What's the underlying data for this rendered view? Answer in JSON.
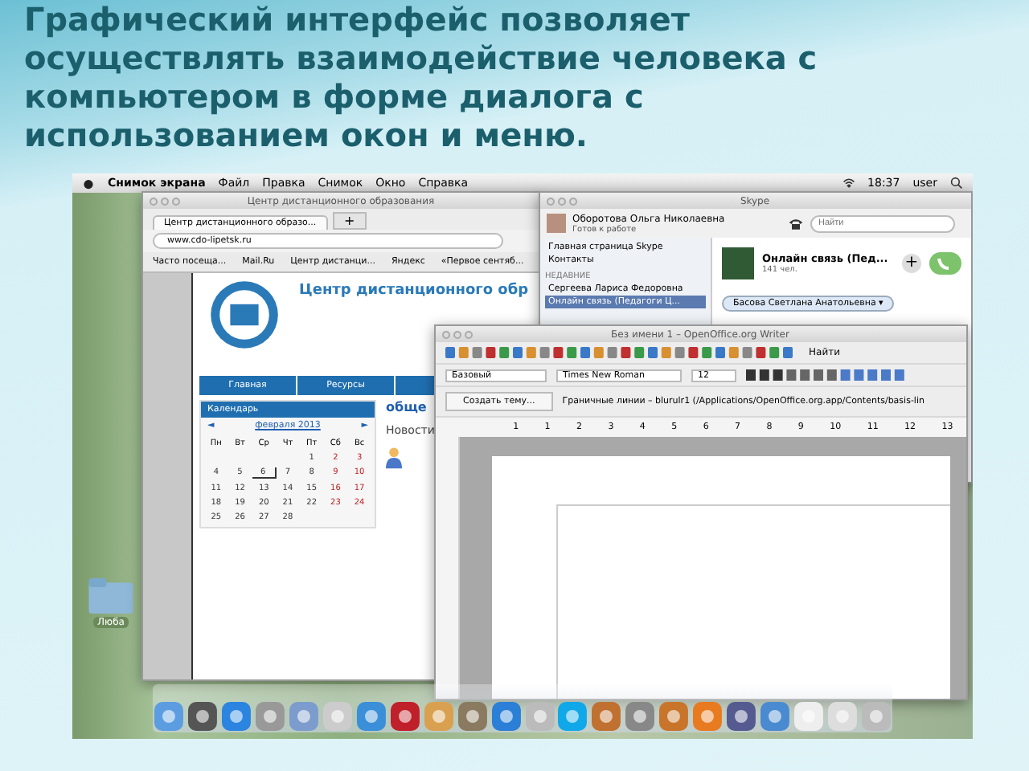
{
  "slide": {
    "text": "**Графический интерфейс** позволяет осуществлять взаимодействие человека с компьютером в форме диалога с использованием окон и меню."
  },
  "menubar": {
    "app": "Снимок экрана",
    "menus": [
      "Файл",
      "Правка",
      "Снимок",
      "Окно",
      "Справка"
    ],
    "time": "18:37",
    "user": "user"
  },
  "folder": {
    "label": "Люба"
  },
  "browser": {
    "title": "Центр дистанционного образования",
    "tab": "Центр дистанционного образо...",
    "new_tab": "+",
    "url": "www.cdo-lipetsk.ru",
    "bookmarks": [
      "Часто посеща...",
      "Mail.Ru",
      "Центр дистанци...",
      "Яндекс",
      "«Первое сентяб..."
    ],
    "site": {
      "title": "Центр дистанционного обр",
      "nav": [
        "Главная",
        "Ресурсы"
      ],
      "calendar_title": "Календарь",
      "month": "февраля 2013",
      "prev": "◄",
      "next": "►",
      "weekdays": [
        "Пн",
        "Вт",
        "Ср",
        "Чт",
        "Пт",
        "Сб",
        "Вс"
      ],
      "weeks": [
        [
          {
            "day": "1",
            "weekend": false,
            "today": false
          },
          {
            "day": "2",
            "weekend": true,
            "today": false
          },
          {
            "day": "3",
            "weekend": true,
            "today": false
          }
        ],
        [
          {
            "day": "4",
            "weekend": false,
            "today": false
          },
          {
            "day": "5",
            "weekend": false,
            "today": false
          },
          {
            "day": "6",
            "weekend": false,
            "today": true
          },
          {
            "day": "7",
            "weekend": false,
            "today": false
          },
          {
            "day": "8",
            "weekend": false,
            "today": false
          },
          {
            "day": "9",
            "weekend": true,
            "today": false
          },
          {
            "day": "10",
            "weekend": true,
            "today": false
          }
        ],
        [
          {
            "day": "11",
            "weekend": false,
            "today": false
          },
          {
            "day": "12",
            "weekend": false,
            "today": false
          },
          {
            "day": "13",
            "weekend": false,
            "today": false
          },
          {
            "day": "14",
            "weekend": false,
            "today": false
          },
          {
            "day": "15",
            "weekend": false,
            "today": false
          },
          {
            "day": "16",
            "weekend": true,
            "today": false
          },
          {
            "day": "17",
            "weekend": true,
            "today": false
          }
        ],
        [
          {
            "day": "18",
            "weekend": false,
            "today": false
          },
          {
            "day": "19",
            "weekend": false,
            "today": false
          },
          {
            "day": "20",
            "weekend": false,
            "today": false
          },
          {
            "day": "21",
            "weekend": false,
            "today": false
          },
          {
            "day": "22",
            "weekend": false,
            "today": false
          },
          {
            "day": "23",
            "weekend": true,
            "today": false
          },
          {
            "day": "24",
            "weekend": true,
            "today": false
          }
        ],
        [
          {
            "day": "25",
            "weekend": false,
            "today": false
          },
          {
            "day": "26",
            "weekend": false,
            "today": false
          },
          {
            "day": "27",
            "weekend": false,
            "today": false
          },
          {
            "day": "28",
            "weekend": false,
            "today": false
          }
        ]
      ],
      "forum_link": "обще",
      "news": "Новости"
    }
  },
  "skype": {
    "title": "Skype",
    "user": "Оборотова Ольга Николаевна",
    "status": "Готов к работе",
    "search_placeholder": "Найти",
    "nav": [
      "Главная страница Skype",
      "Контакты"
    ],
    "recent_heading": "НЕДАВНИЕ",
    "recent": [
      {
        "name": "Сергеева Лариса Федоровна",
        "selected": false
      },
      {
        "name": "Онлайн связь (Педагоги Ц...",
        "selected": true
      }
    ],
    "chat_title": "Онлайн связь (Пед...",
    "chat_members": "141 чел.",
    "add": "+",
    "contact": "Басова Светлана Анатольевна ▾"
  },
  "writer": {
    "title": "Без имени 1 – OpenOffice.org Writer",
    "style": "Базовый",
    "font": "Times New Roman",
    "size": "12",
    "find": "Найти",
    "new_topic": "Создать тему...",
    "path": "Граничные линии – blurulr1 (/Applications/OpenOffice.org.app/Contents/basis-lin",
    "ruler": [
      "1",
      "1",
      "2",
      "3",
      "4",
      "5",
      "6",
      "7",
      "8",
      "9",
      "10",
      "11",
      "12",
      "13"
    ]
  }
}
